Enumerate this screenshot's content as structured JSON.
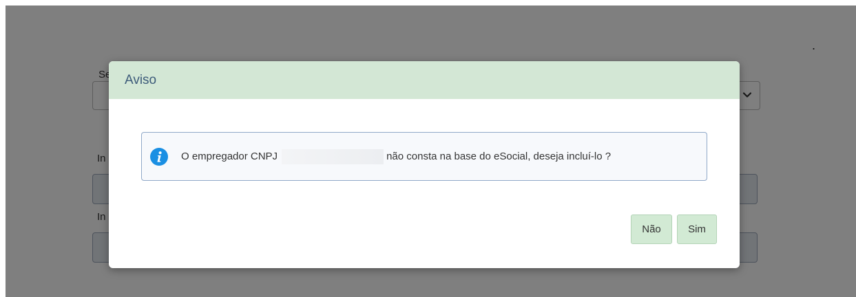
{
  "background": {
    "label_1": "Se",
    "label_2": "In",
    "label_3": "In"
  },
  "modal": {
    "title": "Aviso",
    "message_prefix": "O empregador CNPJ",
    "message_suffix": "não consta na base do eSocial, deseja incluí-lo ?",
    "icon": "info-icon",
    "buttons": {
      "no_label": "Não",
      "yes_label": "Sim"
    }
  },
  "colors": {
    "header_bg": "#d3e7d5",
    "button_bg": "#d2ead4",
    "info_blue": "#1a8fe3",
    "title_color": "#3d5b7a"
  }
}
